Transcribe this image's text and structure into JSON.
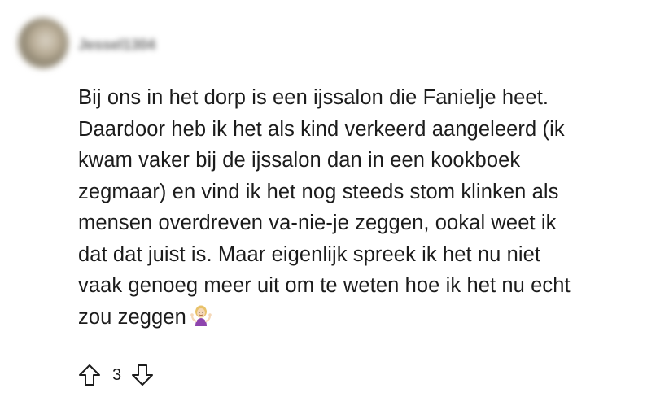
{
  "comment": {
    "username": "Jessel1304",
    "lines": [
      "Bij ons in het dorp is een ijssalon die Fanielje heet.",
      "Daardoor heb ik het als kind verkeerd aangeleerd (ik",
      "kwam vaker bij de ijssalon dan in een kookboek",
      "zegmaar) en vind ik het nog steeds stom klinken als",
      "mensen overdreven va-nie-je zeggen, ookal weet ik",
      "dat dat juist is. Maar eigenlijk spreek ik het nu niet",
      "vaak genoeg meer uit om te weten hoe ik het nu echt",
      "zou zeggen"
    ],
    "emoji": "person-shrugging-emoji"
  },
  "votes": {
    "count": "3",
    "upvote_icon": "arrow-up-icon",
    "downvote_icon": "arrow-down-icon"
  }
}
